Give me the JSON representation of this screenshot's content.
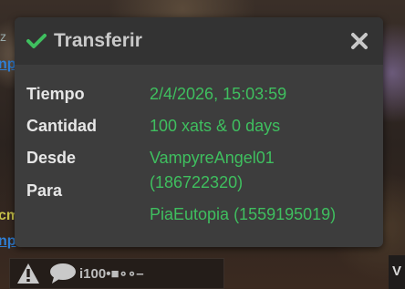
{
  "dialog": {
    "title": "Transferir",
    "rows": [
      {
        "label": "Tiempo",
        "value": "2/4/2026, 15:03:59"
      },
      {
        "label": "Cantidad",
        "value": "100 xats & 0 days"
      },
      {
        "label": "Desde",
        "value": "VampyreAngel01"
      },
      {
        "label": "",
        "value": "(186722320)"
      },
      {
        "label": "Para",
        "value": ""
      },
      {
        "label": "",
        "value": "PiaEutopia (1559195019)"
      }
    ]
  },
  "background": {
    "edge_letter": "z",
    "link1": "np",
    "link2": "np",
    "side_text": "cm"
  },
  "bottom_bar": {
    "text": "i100•■∘∘–",
    "right_badge": "V"
  },
  "colors": {
    "accent": "#3fbf5f",
    "dialog_bg": "#3d3d3d",
    "header_bg": "#333333",
    "label": "#e6e6e6"
  },
  "icons": [
    "check-icon",
    "close-icon",
    "warning-icon",
    "chat-bubble-icon"
  ]
}
